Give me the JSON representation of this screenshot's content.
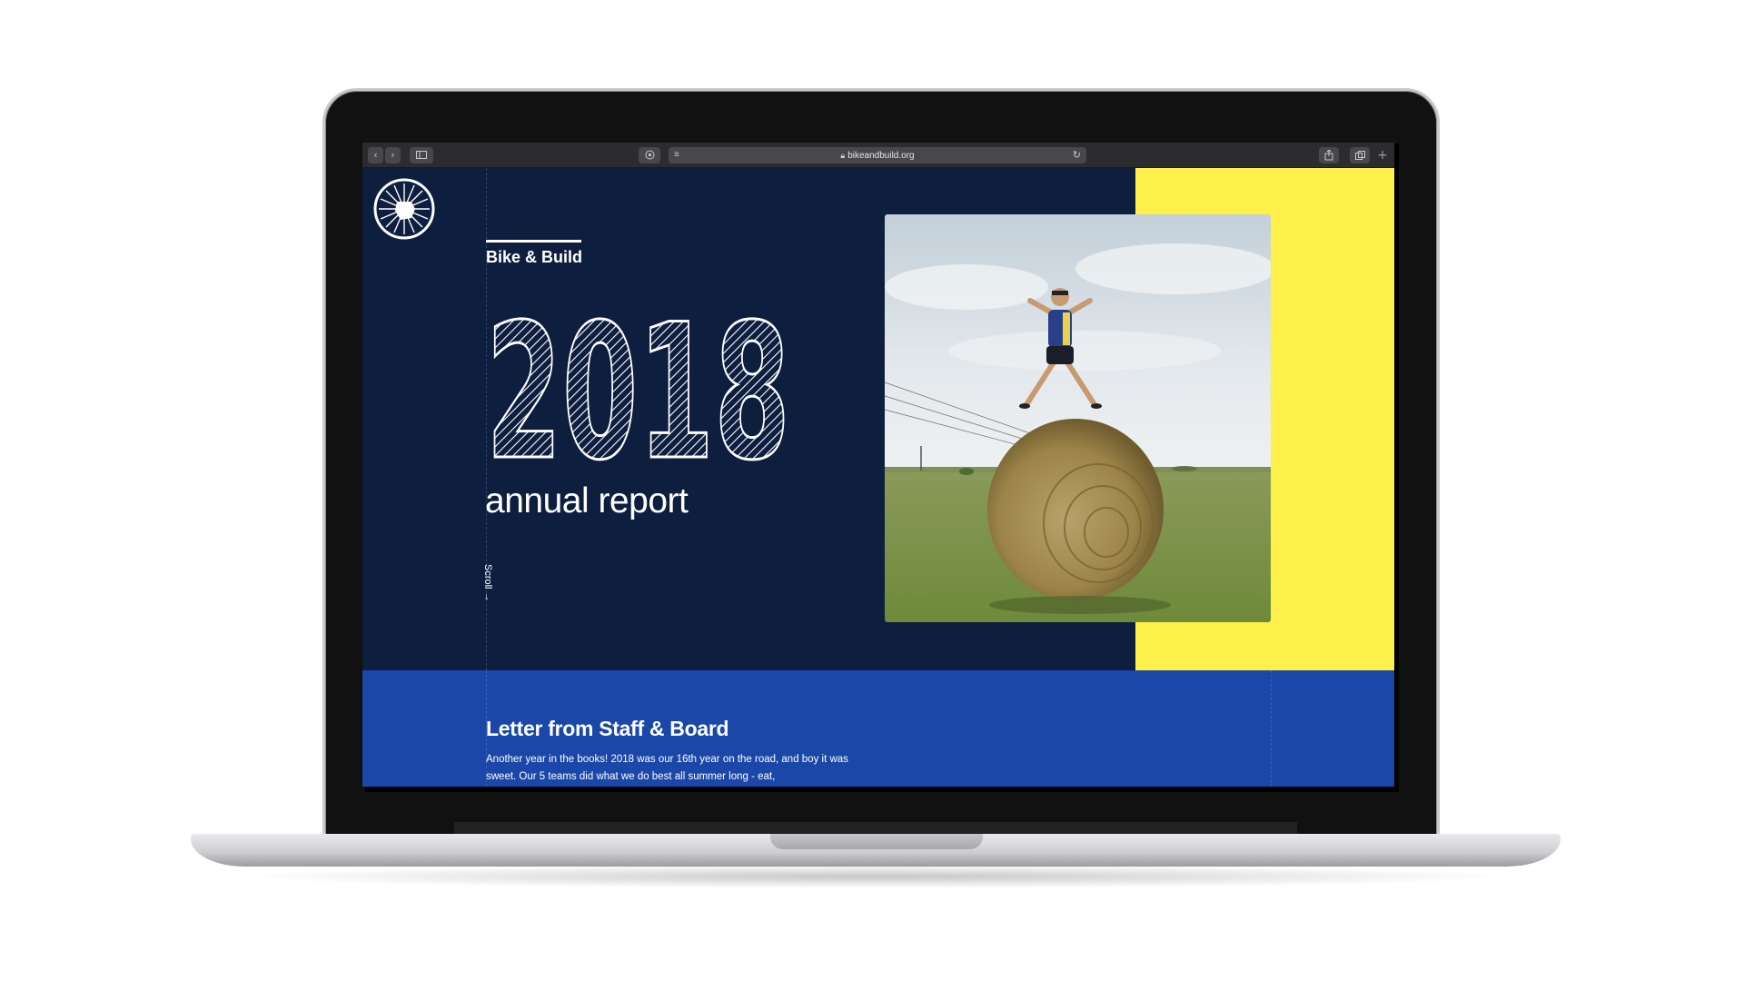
{
  "browser": {
    "url": "bikeandbuild.org",
    "back_icon": "chevron-left-icon",
    "forward_icon": "chevron-right-icon",
    "sidebar_icon": "sidebar-icon",
    "privacy_icon": "shield-icon",
    "reader_icon": "reader-icon",
    "reload_icon": "reload-icon",
    "share_icon": "share-icon",
    "tabs_icon": "tabs-icon",
    "new_tab_icon": "plus-icon"
  },
  "hero": {
    "brand": "Bike & Build",
    "year": "2018",
    "subtitle": "annual report",
    "scroll_label": "Scroll →",
    "colors": {
      "navy": "#0e1e3f",
      "yellow": "#fdf04a",
      "blue": "#1a47a8"
    }
  },
  "letter": {
    "title": "Letter from Staff & Board",
    "body": "Another year in the books! 2018 was our 16th year on the road, and boy it was sweet. Our 5 teams did what we do best all summer long - eat,"
  }
}
